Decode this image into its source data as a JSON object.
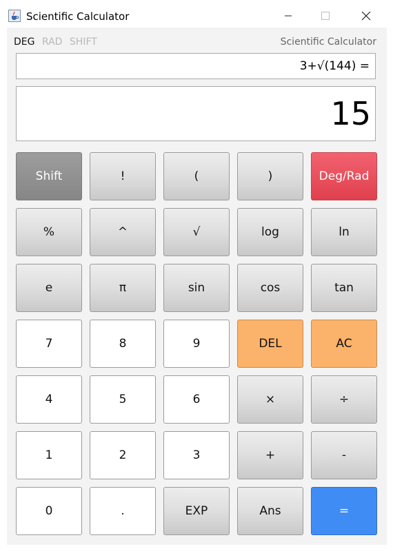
{
  "window": {
    "title": "Scientific Calculator",
    "controls": {
      "minimize": "—",
      "maximize": "☐",
      "close": "✕"
    }
  },
  "mode": {
    "deg": "DEG",
    "rad": "RAD",
    "shift": "SHIFT",
    "active": "DEG",
    "label": "Scientific Calculator"
  },
  "display": {
    "expression": "3+√(144) =",
    "result": "15"
  },
  "keys": {
    "shift": "Shift",
    "fact": "!",
    "lparen": "(",
    "rparen": ")",
    "degrad": "Deg/Rad",
    "percent": "%",
    "power": "^",
    "sqrt": "√",
    "log": "log",
    "ln": "ln",
    "e": "e",
    "pi": "π",
    "sin": "sin",
    "cos": "cos",
    "tan": "tan",
    "n7": "7",
    "n8": "8",
    "n9": "9",
    "del": "DEL",
    "ac": "AC",
    "n4": "4",
    "n5": "5",
    "n6": "6",
    "mul": "×",
    "div": "÷",
    "n1": "1",
    "n2": "2",
    "n3": "3",
    "plus": "+",
    "minus": "-",
    "n0": "0",
    "dot": ".",
    "exp": "EXP",
    "ans": "Ans",
    "equals": "="
  },
  "colors": {
    "shift": "#8f8f8f",
    "degrad": "#e8505d",
    "orange": "#fbb26a",
    "equals": "#3f8cf5"
  }
}
